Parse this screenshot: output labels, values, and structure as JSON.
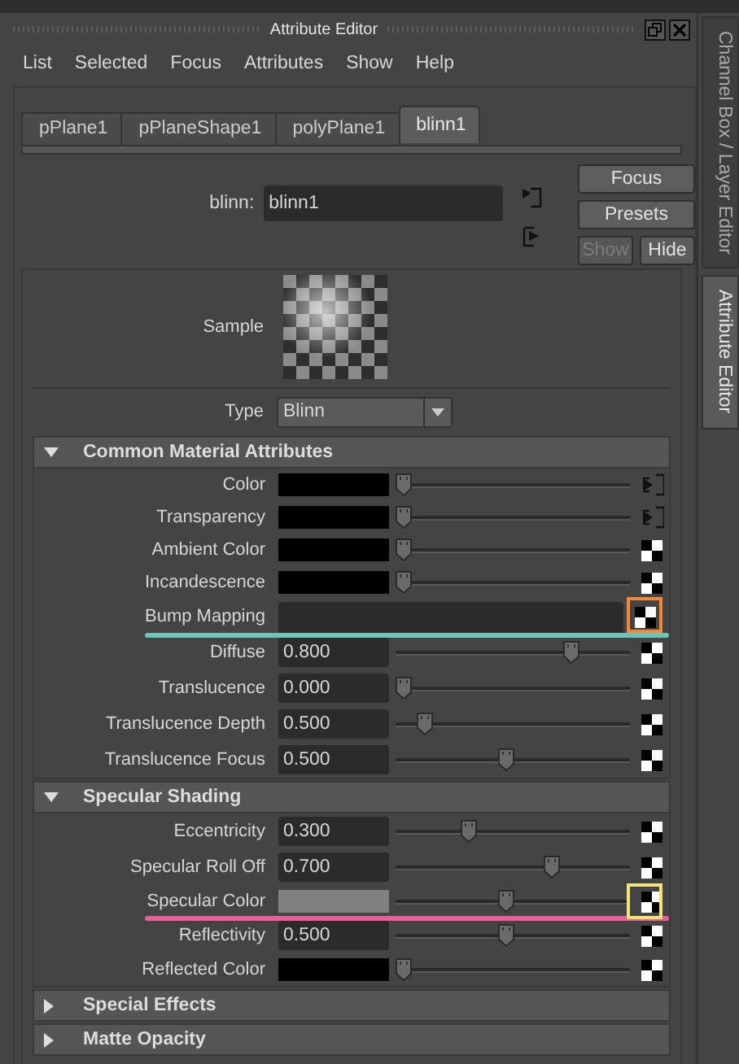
{
  "window": {
    "title": "Attribute Editor"
  },
  "menu": [
    "List",
    "Selected",
    "Focus",
    "Attributes",
    "Show",
    "Help"
  ],
  "tabs": [
    {
      "label": "pPlane1",
      "selected": false
    },
    {
      "label": "pPlaneShape1",
      "selected": false
    },
    {
      "label": "polyPlane1",
      "selected": false
    },
    {
      "label": "blinn1",
      "selected": true
    }
  ],
  "node": {
    "label": "blinn:",
    "value": "blinn1"
  },
  "buttons": [
    {
      "label": "Focus",
      "disabled": false
    },
    {
      "label": "Presets",
      "disabled": false
    },
    {
      "label": "Show",
      "disabled": true
    },
    {
      "label": "Hide",
      "disabled": false
    }
  ],
  "sample": {
    "label": "Sample"
  },
  "type": {
    "label": "Type",
    "value": "Blinn"
  },
  "sections": [
    {
      "title": "Common Material Attributes",
      "expanded": true,
      "rows": [
        {
          "kind": "color",
          "label": "Color",
          "color": "#000000",
          "level": 0,
          "map_button": {
            "kind": "connect"
          }
        },
        {
          "kind": "color",
          "label": "Transparency",
          "color": "#000000",
          "level": 0,
          "map_button": {
            "kind": "connect"
          }
        },
        {
          "kind": "color",
          "label": "Ambient Color",
          "color": "#000000",
          "level": 0,
          "map_button": {
            "kind": "checker"
          }
        },
        {
          "kind": "color",
          "label": "Incandescence",
          "color": "#000000",
          "level": 0,
          "map_button": {
            "kind": "checker"
          }
        },
        {
          "kind": "map",
          "label": "Bump Mapping",
          "map_button": {
            "kind": "checker"
          },
          "marker": {
            "underline": {
              "color": "#6cc4bb"
            },
            "box": {
              "color": "#f08a3a"
            }
          }
        },
        {
          "kind": "number",
          "label": "Diffuse",
          "value": "0.800",
          "level": 0.77,
          "map_button": {
            "kind": "checker"
          }
        },
        {
          "kind": "number",
          "label": "Translucence",
          "value": "0.000",
          "level": 0,
          "map_button": {
            "kind": "checker"
          }
        },
        {
          "kind": "number",
          "label": "Translucence Depth",
          "value": "0.500",
          "level": 0.1,
          "map_button": {
            "kind": "checker"
          }
        },
        {
          "kind": "number",
          "label": "Translucence Focus",
          "value": "0.500",
          "level": 0.47,
          "map_button": {
            "kind": "checker"
          }
        }
      ]
    },
    {
      "title": "Specular Shading",
      "expanded": true,
      "rows": [
        {
          "kind": "number",
          "label": "Eccentricity",
          "value": "0.300",
          "level": 0.3,
          "map_button": {
            "kind": "checker"
          }
        },
        {
          "kind": "number",
          "label": "Specular Roll Off",
          "value": "0.700",
          "level": 0.68,
          "map_button": {
            "kind": "checker"
          }
        },
        {
          "kind": "color",
          "label": "Specular Color",
          "color": "#808080",
          "level": 0.47,
          "map_button": {
            "kind": "checker"
          },
          "marker": {
            "underline": {
              "color": "#e8609a"
            },
            "box": {
              "color": "#f3e47a"
            }
          }
        },
        {
          "kind": "number",
          "label": "Reflectivity",
          "value": "0.500",
          "level": 0.47,
          "map_button": {
            "kind": "checker"
          }
        },
        {
          "kind": "color",
          "label": "Reflected Color",
          "color": "#000000",
          "level": 0,
          "map_button": {
            "kind": "checker"
          }
        }
      ]
    },
    {
      "title": "Special Effects",
      "expanded": false
    },
    {
      "title": "Matte Opacity",
      "expanded": false
    }
  ],
  "side_tabs": [
    {
      "label": "Channel Box / Layer Editor",
      "selected": false
    },
    {
      "label": "Attribute Editor",
      "selected": true
    }
  ]
}
